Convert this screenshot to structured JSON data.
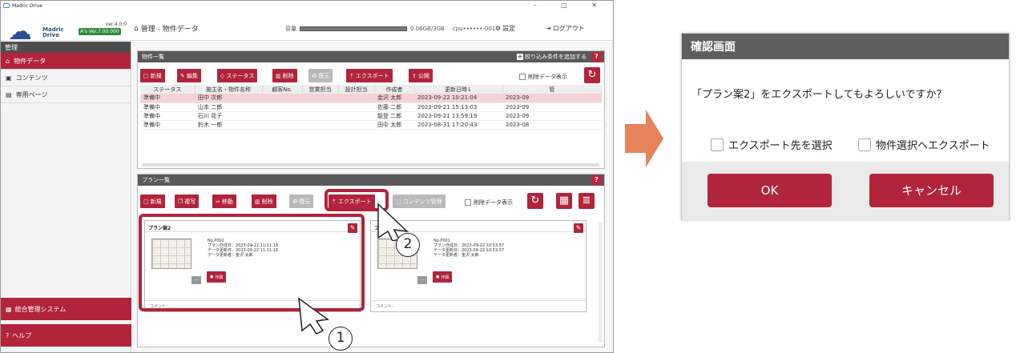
{
  "app": {
    "title": "Madric Drive",
    "version": "ver.4.0.0",
    "as_version": "A's Ver.7.00.000",
    "brand_line1": "Madric",
    "brand_line2": "Drive",
    "window_controls": "–  □  ✕"
  },
  "header": {
    "breadcrumb": "管理 - 物件データ",
    "capacity_label": "容量",
    "capacity_text": "0.06GB/3GB",
    "capacity_fraction": 0.02,
    "cpu": "cpu••••••-001",
    "settings": "設定",
    "logout": "ログアウト"
  },
  "sidebar": {
    "section": "管理",
    "items": [
      {
        "label": "物件データ",
        "active": true
      },
      {
        "label": "コンテンツ",
        "active": false
      },
      {
        "label": "専用ページ",
        "active": false
      }
    ],
    "system": "総合管理システム",
    "help": "ヘルプ"
  },
  "property_panel": {
    "title": "物件一覧",
    "add_filter": "絞り込み条件を追加する",
    "help": "?",
    "toolbar": {
      "new": "新規",
      "edit": "編集",
      "status": "ステータス",
      "delete": "削除",
      "restore": "復元",
      "export": "エクスポート",
      "publish": "公開",
      "show_deleted": "削除データ表示"
    },
    "columns": [
      "ステータス",
      "施主名・物件名称",
      "顧客No.",
      "営業担当",
      "設計担当",
      "作成者",
      "更新日時↓",
      "管"
    ],
    "rows": [
      {
        "status": "準備中",
        "name": "田中 次郎",
        "no": "",
        "sales": "",
        "design": "",
        "creator": "金沢 太郎",
        "updated": "2023-09-22 10:21:04",
        "more": "2023-09"
      },
      {
        "status": "準備中",
        "name": "山本 二郎",
        "no": "",
        "sales": "",
        "design": "",
        "creator": "佐藤 二郎",
        "updated": "2023-09-21 15:13:03",
        "more": "2023-09"
      },
      {
        "status": "準備中",
        "name": "石川 花子",
        "no": "",
        "sales": "",
        "design": "",
        "creator": "能登 二郎",
        "updated": "2023-09-21 13:59:19",
        "more": "2023-09"
      },
      {
        "status": "準備中",
        "name": "鈴木 一郎",
        "no": "",
        "sales": "",
        "design": "",
        "creator": "田中 太郎",
        "updated": "2023-08-31 17:20:43",
        "more": "2023-08"
      }
    ]
  },
  "plan_panel": {
    "title": "プラン一覧",
    "help": "?",
    "toolbar": {
      "new": "新規",
      "copy": "複写",
      "move": "移動",
      "delete": "削除",
      "restore": "復元",
      "export": "エクスポート",
      "contents": "コンテンツ管理",
      "show_deleted": "削除データ表示"
    },
    "cards": [
      {
        "title": "プラン案2",
        "no": "No.P002",
        "created": "プラン作成日：2023-09-22 11:11:18",
        "updated": "データ更新日：2023-09-22 11:11:18",
        "updater": "データ更新者：金沢 太郎",
        "draw": "作図",
        "more": "…",
        "comment": "コメント："
      },
      {
        "title": "プ",
        "no": "No.P001",
        "created": "プラン作成日：2023-09-22 10:53:57",
        "updated": "データ更新日：2023-09-22 10:53:57",
        "updater": "データ更新者：金沢 太郎",
        "draw": "作図",
        "more": "…",
        "comment": "コメント："
      }
    ]
  },
  "callouts": {
    "one": "1",
    "two": "2"
  },
  "dialog": {
    "title": "確認画面",
    "message": "「プラン案2」をエクスポートしてもよろしいですか？",
    "option1": "エクスポート先を選択",
    "option2": "物件選択へエクスポート",
    "ok": "OK",
    "cancel": "キャンセル"
  },
  "colors": {
    "accent": "#b1243b",
    "arrow": "#e8825a",
    "header_gray": "#595959"
  }
}
